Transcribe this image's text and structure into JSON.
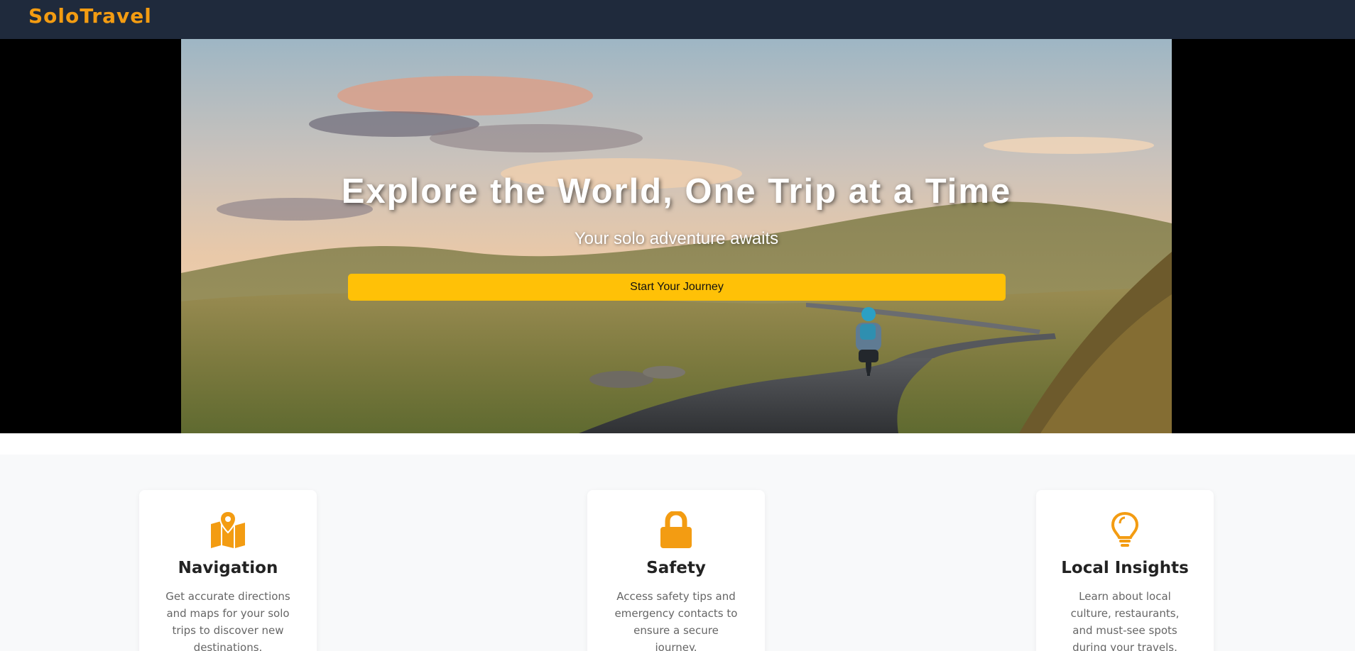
{
  "navbar": {
    "brand": "SoloTravel"
  },
  "hero": {
    "title": "Explore the World, One Trip at a Time",
    "subtitle": "Your solo adventure awaits",
    "cta_label": "Start Your Journey"
  },
  "colors": {
    "accent": "#f39c12",
    "cta": "#ffc107",
    "navbar": "#1f2a3c"
  },
  "features": [
    {
      "icon": "map-marker-icon",
      "title": "Navigation",
      "text": "Get accurate directions and maps for your solo trips to discover new destinations."
    },
    {
      "icon": "lock-icon",
      "title": "Safety",
      "text": "Access safety tips and emergency contacts to ensure a secure journey."
    },
    {
      "icon": "lightbulb-icon",
      "title": "Local Insights",
      "text": "Learn about local culture, restaurants, and must-see spots during your travels."
    }
  ]
}
